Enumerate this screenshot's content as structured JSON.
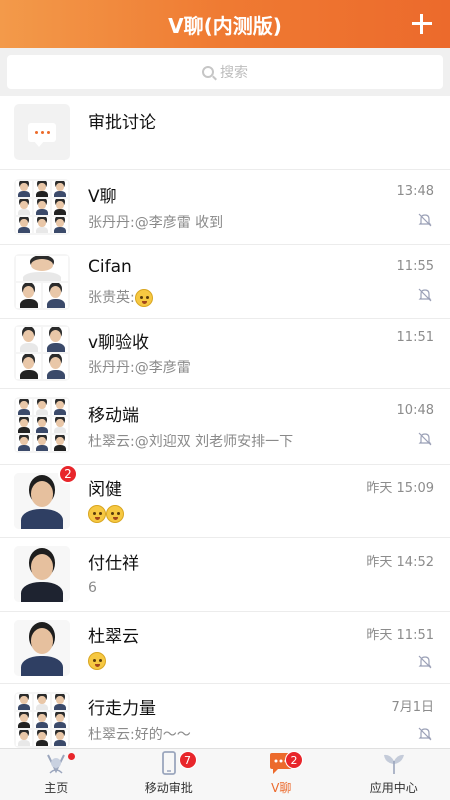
{
  "header": {
    "title": "V聊(内测版)"
  },
  "search": {
    "placeholder": "搜索"
  },
  "chats": [
    {
      "name": "审批讨论",
      "time": "",
      "message": ""
    },
    {
      "name": "V聊",
      "time": "13:48",
      "message": "张丹丹:@李彦雷 收到"
    },
    {
      "name": "Cifan",
      "time": "11:55",
      "message": "张贵英:"
    },
    {
      "name": "v聊验收",
      "time": "11:51",
      "message": "张丹丹:@李彦雷"
    },
    {
      "name": "移动端",
      "time": "10:48",
      "message": "杜翠云:@刘迎双 刘老师安排一下"
    },
    {
      "name": "闵健",
      "time": "昨天 15:09",
      "message": "",
      "badge": "2"
    },
    {
      "name": "付仕祥",
      "time": "昨天 14:52",
      "message": "6"
    },
    {
      "name": "杜翠云",
      "time": "昨天 11:51",
      "message": ""
    },
    {
      "name": "行走力量",
      "time": "7月1日",
      "message": "杜翠云:好的～～"
    }
  ],
  "tabs": [
    {
      "label": "主页"
    },
    {
      "label": "移动审批",
      "badge": "7"
    },
    {
      "label": "V聊",
      "badge": "2"
    },
    {
      "label": "应用中心"
    }
  ],
  "colors": {
    "accent": "#ec6a2c",
    "badge": "#e8262b"
  }
}
